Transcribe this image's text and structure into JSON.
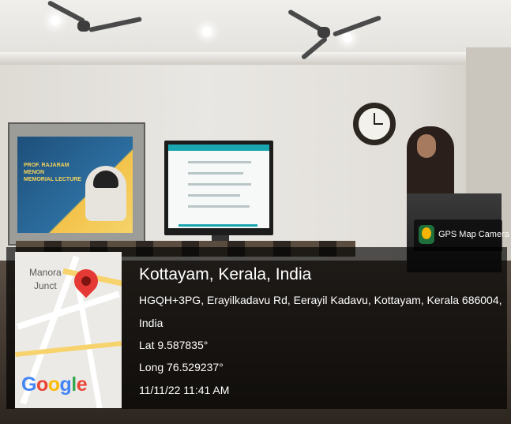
{
  "gps_badge": {
    "icon": "map-pin-icon",
    "label": "GPS Map Camera"
  },
  "map_thumbnail": {
    "place_label_line1": "Manora",
    "place_label_line2": "Junct",
    "pin_icon": "map-marker-icon",
    "logo_text": [
      "G",
      "o",
      "o",
      "g",
      "l",
      "e"
    ],
    "logo_colors": [
      "#4285f4",
      "#ea4335",
      "#fbbc05",
      "#4285f4",
      "#34a853",
      "#ea4335"
    ]
  },
  "location": {
    "title": "Kottayam, Kerala, India",
    "address_line1": "HGQH+3PG, Erayilkadavu Rd, Eerayil Kadavu, Kottayam, Kerala 686004,",
    "address_line2": "India",
    "latitude": "Lat 9.587835°",
    "longitude": "Long 76.529237°",
    "timestamp": "11/11/22 11:41 AM"
  },
  "poster": {
    "title_line1": "PROF. RAJARAM MENON",
    "title_line2": "MEMORIAL LECTURE"
  }
}
